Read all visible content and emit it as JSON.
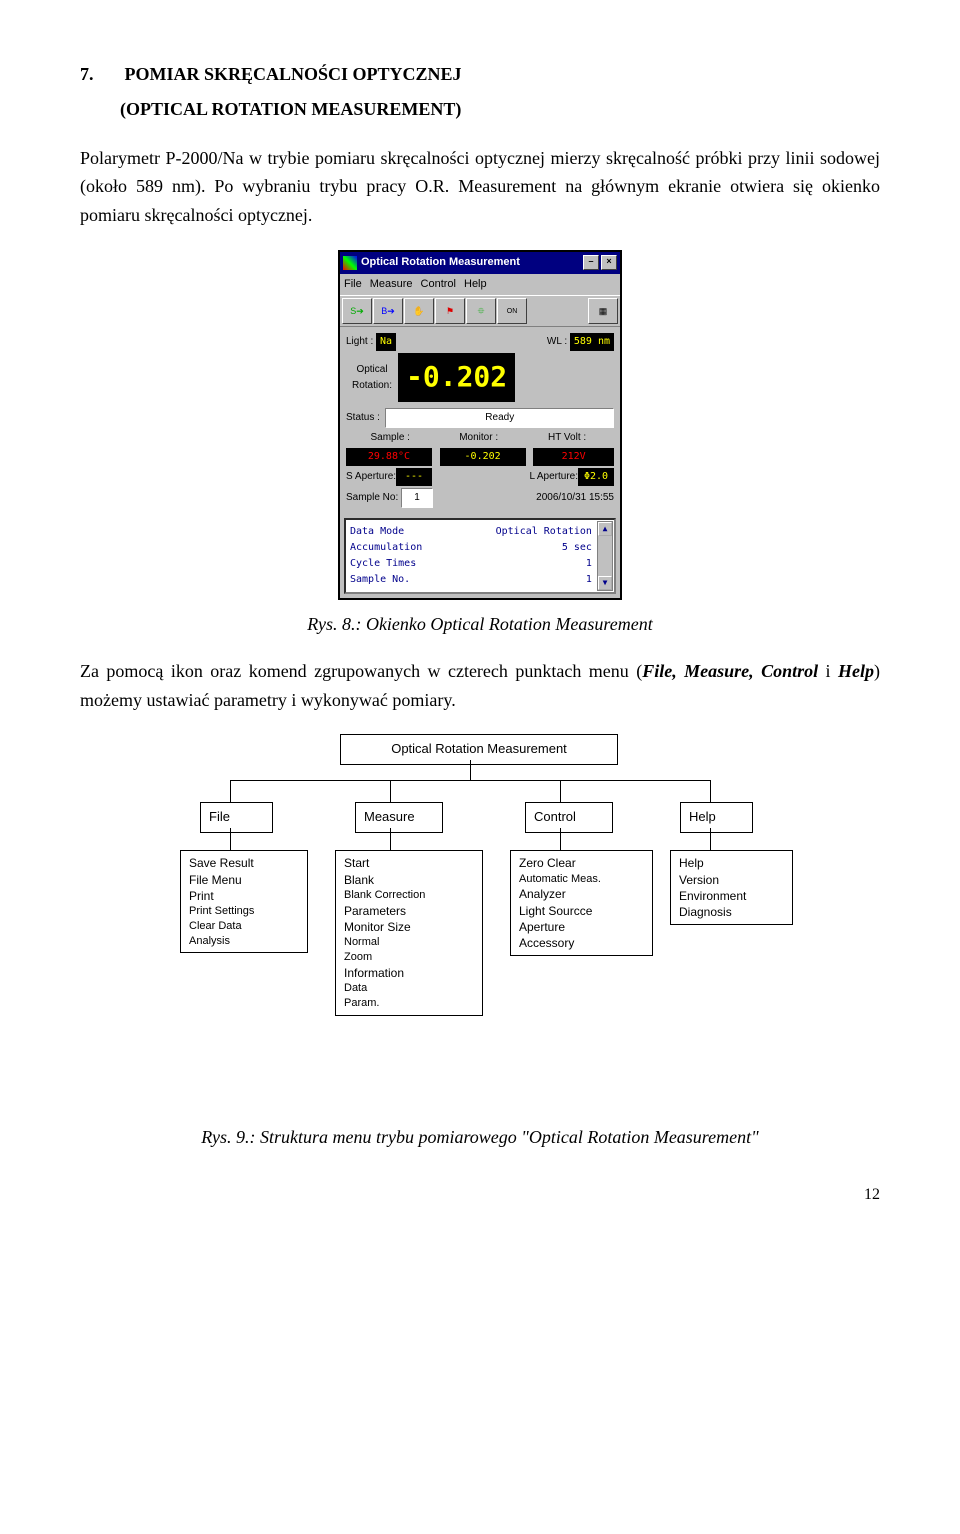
{
  "section": {
    "number": "7.",
    "title": "POMIAR SKRĘCALNOŚCI  OPTYCZNEJ",
    "subtitle": "(OPTICAL ROTATION MEASUREMENT)"
  },
  "para1": "Polarymetr P-2000/Na w trybie pomiaru skręcalności optycznej mierzy skręcalność próbki przy linii sodowej (około 589 nm). Po wybraniu trybu pracy O.R. Measurement na głównym ekranie otwiera się okienko pomiaru skręcalności optycznej.",
  "fig8": {
    "window_title": "Optical Rotation Measurement",
    "menus": [
      "File",
      "Measure",
      "Control",
      "Help"
    ],
    "toolbar_icons": [
      "s-arrow-icon",
      "b-icon",
      "hand-icon",
      "flag-icon",
      "target-icon",
      "toggle-on-icon",
      "grid-icon"
    ],
    "light_label": "Light :",
    "light_value": "Na",
    "wl_label": "WL :",
    "wl_value": "589 nm",
    "or_label_1": "Optical",
    "or_label_2": "Rotation:",
    "or_value": "-0.202",
    "status_label": "Status :",
    "status_value": "Ready",
    "sample_label": "Sample :",
    "monitor_label": "Monitor :",
    "ht_label": "HT Volt :",
    "sample_val": "29.88°C",
    "monitor_val": "-0.202",
    "ht_val": "212V",
    "s_ap_label": "S Aperture:",
    "s_ap_val": "---",
    "l_ap_label": "L Aperture:",
    "l_ap_val": "Φ2.0",
    "sample_no_label": "Sample No:",
    "sample_no_val": "1",
    "datetime": "2006/10/31 15:55",
    "list": {
      "r1a": "Data Mode",
      "r1b": "Optical Rotation",
      "r2a": "Accumulation",
      "r2b": "5 sec",
      "r3a": "Cycle Times",
      "r3b": "1",
      "r4a": "Sample No.",
      "r4b": "1"
    }
  },
  "caption8": "Rys. 8.: Okienko Optical Rotation Measurement",
  "para2_a": "Za pomocą ikon oraz komend zgrupowanych w czterech punktach menu (",
  "para2_b": "File, Measure, Control",
  "para2_c": " i ",
  "para2_d": "Help",
  "para2_e": ") możemy ustawiać parametry i wykonywać pomiary.",
  "fig9": {
    "root": "Optical    Rotation    Measurement",
    "file": "File",
    "measure": "Measure",
    "control": "Control",
    "help": "Help",
    "file_items": [
      "Save Result",
      "File Menu",
      "Print",
      "Print Settings",
      "Clear Data",
      "Analysis"
    ],
    "measure_items": [
      "Start",
      "Blank",
      "  Blank Correction",
      "Parameters",
      "Monitor Size",
      "  Normal",
      "  Zoom",
      "Information",
      "  Data",
      "  Param."
    ],
    "control_items": [
      "Zero Clear",
      "  Automatic Meas.",
      "Analyzer",
      "Light Sourcce",
      "Aperture",
      "Accessory"
    ],
    "help_items": [
      "Help",
      "Version",
      "Environment",
      "Diagnosis"
    ]
  },
  "caption9": "Rys. 9.: Struktura menu trybu pomiarowego \"Optical Rotation Measurement\"",
  "page_number": "12"
}
